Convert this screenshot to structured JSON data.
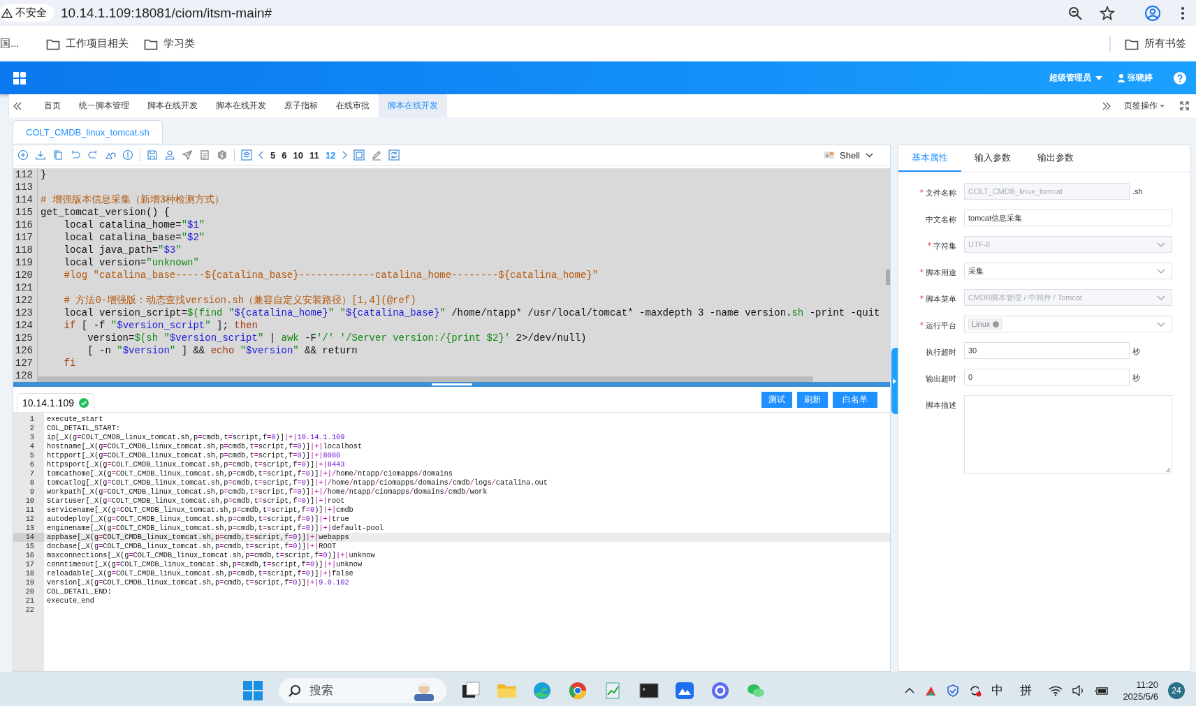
{
  "browser": {
    "security": "不安全",
    "url": "10.14.1.109:18081/ciom/itsm-main#",
    "bookmarks": [
      {
        "label": "国...",
        "kind": "cut"
      },
      {
        "label": "工作项目相关",
        "kind": "folder"
      },
      {
        "label": "学习类",
        "kind": "folder"
      }
    ],
    "all_bookmarks": "所有书签"
  },
  "header": {
    "role": "超级管理员",
    "user": "张晓婷"
  },
  "tabs": [
    {
      "label": "首页",
      "selected": false
    },
    {
      "label": "统一脚本管理",
      "selected": false
    },
    {
      "label": "脚本在线开发",
      "selected": false
    },
    {
      "label": "脚本在线开发",
      "selected": false
    },
    {
      "label": "原子指标",
      "selected": false
    },
    {
      "label": "在线审批",
      "selected": false
    },
    {
      "label": "脚本在线开发",
      "selected": true
    }
  ],
  "tab_actions": "页签操作",
  "file_tab": "COLT_CMDB_linux_tomcat.sh",
  "font_sizes": [
    {
      "label": "5",
      "selected": false
    },
    {
      "label": "6",
      "selected": false
    },
    {
      "label": "10",
      "selected": false
    },
    {
      "label": "11",
      "selected": false
    },
    {
      "label": "12",
      "selected": true
    }
  ],
  "language": "Shell",
  "code": [
    {
      "n": "112",
      "text": "}"
    },
    {
      "n": "113"
    },
    {
      "n": "114",
      "text": "# 增强版本信息采集（新增3种检测方式）"
    },
    {
      "n": "115",
      "text": "get_tomcat_version() {"
    },
    {
      "n": "116",
      "text": "    local catalina_home=\"$1\""
    },
    {
      "n": "117",
      "text": "    local catalina_base=\"$2\""
    },
    {
      "n": "118",
      "text": "    local java_path=\"$3\""
    },
    {
      "n": "119",
      "text": "    local version=\"unknown\""
    },
    {
      "n": "120",
      "text": "    #log \"catalina_base-----${catalina_base}-------------catalina_home--------${catalina_home}\""
    },
    {
      "n": "121"
    },
    {
      "n": "122",
      "text": "    # 方法0-增强版：动态查找version.sh（兼容自定义安装路径）[1,4](@ref)"
    },
    {
      "n": "123",
      "text": "    local version_script=$(find \"${catalina_home}\" \"${catalina_base}\" /home/ntapp* /usr/local/tomcat* -maxdepth 3 -name version.sh -print -quit"
    },
    {
      "n": "124",
      "text": "    if [ -f \"$version_script\" ]; then"
    },
    {
      "n": "125",
      "text": "        version=$(sh \"$version_script\" | awk -F'/' '/Server version:/{print $2}' 2>/dev/null)"
    },
    {
      "n": "126",
      "text": "        [ -n \"$version\" ] && echo \"$version\" && return"
    },
    {
      "n": "127",
      "text": "    fi"
    },
    {
      "n": "128"
    }
  ],
  "output": {
    "host": "10.14.1.109",
    "host_ok": true,
    "buttons": [
      "测试",
      "刷新",
      "白名单"
    ],
    "lines": [
      {
        "n": "1",
        "text": "execute_start",
        "selected": false
      },
      {
        "n": "2",
        "text": "COL_DETAIL_START:",
        "selected": false
      },
      {
        "n": "3",
        "text": "ip[_X(g=COLT_CMDB_linux_tomcat.sh,p=cmdb,t=script,f=0)]|+|10.14.1.109",
        "selected": false
      },
      {
        "n": "4",
        "text": "hostname[_X(g=COLT_CMDB_linux_tomcat.sh,p=cmdb,t=script,f=0)]|+|localhost",
        "selected": false
      },
      {
        "n": "5",
        "text": "httpport[_X(g=COLT_CMDB_linux_tomcat.sh,p=cmdb,t=script,f=0)]|+|8080",
        "selected": false
      },
      {
        "n": "6",
        "text": "httpsport[_X(g=COLT_CMDB_linux_tomcat.sh,p=cmdb,t=script,f=0)]|+|8443",
        "selected": false
      },
      {
        "n": "7",
        "text": "tomcathome[_X(g=COLT_CMDB_linux_tomcat.sh,p=cmdb,t=script,f=0)]|+|/home/ntapp/ciomapps/domains",
        "selected": false
      },
      {
        "n": "8",
        "text": "tomcatlog[_X(g=COLT_CMDB_linux_tomcat.sh,p=cmdb,t=script,f=0)]|+|/home/ntapp/ciomapps/domains/cmdb/logs/catalina.out",
        "selected": false
      },
      {
        "n": "9",
        "text": "workpath[_X(g=COLT_CMDB_linux_tomcat.sh,p=cmdb,t=script,f=0)]|+|/home/ntapp/ciomapps/domains/cmdb/work",
        "selected": false
      },
      {
        "n": "10",
        "text": "Startuser[_X(g=COLT_CMDB_linux_tomcat.sh,p=cmdb,t=script,f=0)]|+|root",
        "selected": false
      },
      {
        "n": "11",
        "text": "servicename[_X(g=COLT_CMDB_linux_tomcat.sh,p=cmdb,t=script,f=0)]|+|cmdb",
        "selected": false
      },
      {
        "n": "12",
        "text": "autodeploy[_X(g=COLT_CMDB_linux_tomcat.sh,p=cmdb,t=script,f=0)]|+|true",
        "selected": false
      },
      {
        "n": "13",
        "text": "enginename[_X(g=COLT_CMDB_linux_tomcat.sh,p=cmdb,t=script,f=0)]|+|default-pool",
        "selected": false
      },
      {
        "n": "14",
        "text": "appbase[_X(g=COLT_CMDB_linux_tomcat.sh,p=cmdb,t=script,f=0)]|+|webapps",
        "selected": true
      },
      {
        "n": "15",
        "text": "docbase[_X(g=COLT_CMDB_linux_tomcat.sh,p=cmdb,t=script,f=0)]|+|ROOT",
        "selected": false
      },
      {
        "n": "16",
        "text": "maxconnections[_X(g=COLT_CMDB_linux_tomcat.sh,p=cmdb,t=script,f=0)]|+|unknow",
        "selected": false
      },
      {
        "n": "17",
        "text": "conntimeout[_X(g=COLT_CMDB_linux_tomcat.sh,p=cmdb,t=script,f=0)]|+|unknow",
        "selected": false
      },
      {
        "n": "18",
        "text": "reloadable[_X(g=COLT_CMDB_linux_tomcat.sh,p=cmdb,t=script,f=0)]|+|false",
        "selected": false
      },
      {
        "n": "19",
        "text": "version[_X(g=COLT_CMDB_linux_tomcat.sh,p=cmdb,t=script,f=0)]|+|9.0.102",
        "selected": false
      },
      {
        "n": "20",
        "text": "COL_DETAIL_END:",
        "selected": false
      },
      {
        "n": "21",
        "text": "execute_end",
        "selected": false
      },
      {
        "n": "22",
        "selected": false
      }
    ]
  },
  "properties": {
    "tabs": [
      {
        "label": "基本属性",
        "selected": true
      },
      {
        "label": "输入参数",
        "selected": false
      },
      {
        "label": "输出参数",
        "selected": false
      }
    ],
    "fields": [
      {
        "label": "文件名称",
        "required": true,
        "kind": "text",
        "value": "COLT_CMDB_linux_tomcat",
        "disabled": true,
        "suffix": ".sh"
      },
      {
        "label": "中文名称",
        "required": false,
        "kind": "text",
        "value": "tomcat信息采集",
        "disabled": false
      },
      {
        "label": "字符集",
        "required": true,
        "kind": "select",
        "value": "UTF-8",
        "disabled": true
      },
      {
        "label": "脚本用途",
        "required": true,
        "kind": "select",
        "value": "采集",
        "disabled": false
      },
      {
        "label": "脚本菜单",
        "required": true,
        "kind": "select",
        "value": "CMDB脚本管理 / 中间件 / Tomcat",
        "disabled": true
      },
      {
        "label": "运行平台",
        "required": true,
        "kind": "tags",
        "value": "Linux",
        "disabled": false
      },
      {
        "label": "执行超时",
        "required": false,
        "kind": "text",
        "value": "30",
        "disabled": false,
        "suffix": "秒"
      },
      {
        "label": "输出超时",
        "required": false,
        "kind": "text",
        "value": "0",
        "disabled": false,
        "suffix": "秒"
      },
      {
        "label": "脚本描述",
        "required": false,
        "kind": "textarea",
        "disabled": false
      }
    ]
  },
  "taskbar": {
    "search": "搜索",
    "ime_1": "中",
    "ime_2": "拼",
    "time": "11:20",
    "date": "2025/5/6",
    "badge": "24"
  }
}
